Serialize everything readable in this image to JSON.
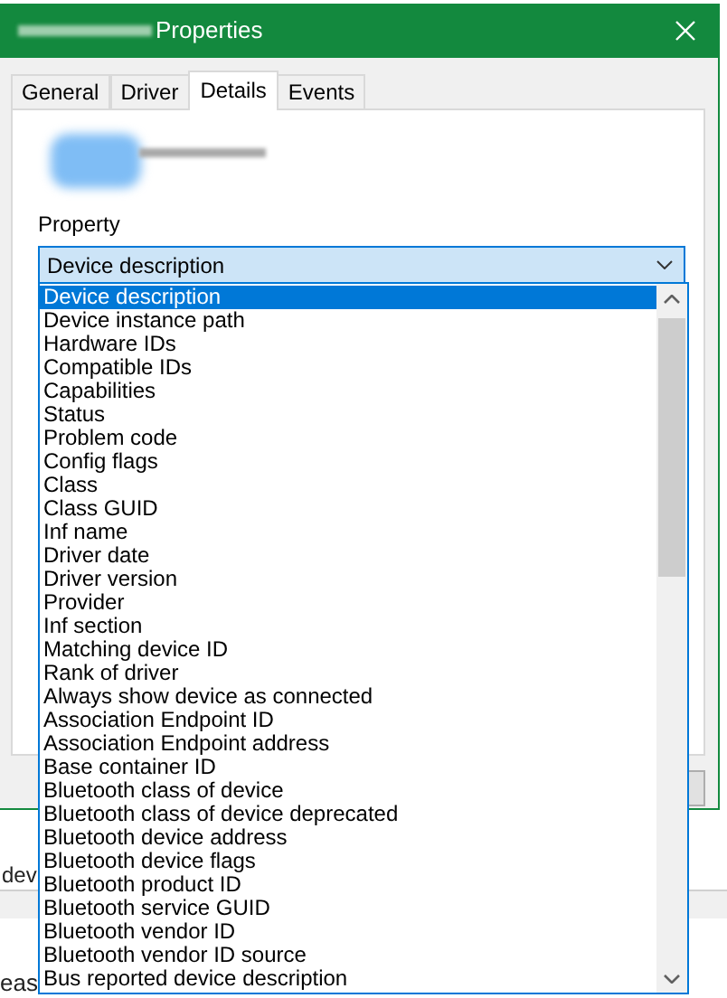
{
  "window": {
    "title": "Properties"
  },
  "tabs": [
    {
      "label": "General",
      "selected": false
    },
    {
      "label": "Driver",
      "selected": false
    },
    {
      "label": "Details",
      "selected": true
    },
    {
      "label": "Events",
      "selected": false
    }
  ],
  "property_label": "Property",
  "property_combo": {
    "value": "Device description",
    "expanded": true
  },
  "dropdown_items": [
    {
      "label": "Device description",
      "selected": true
    },
    {
      "label": "Device instance path",
      "selected": false
    },
    {
      "label": "Hardware IDs",
      "selected": false
    },
    {
      "label": "Compatible IDs",
      "selected": false
    },
    {
      "label": "Capabilities",
      "selected": false
    },
    {
      "label": "Status",
      "selected": false
    },
    {
      "label": "Problem code",
      "selected": false
    },
    {
      "label": "Config flags",
      "selected": false
    },
    {
      "label": "Class",
      "selected": false
    },
    {
      "label": "Class GUID",
      "selected": false
    },
    {
      "label": "Inf name",
      "selected": false
    },
    {
      "label": "Driver date",
      "selected": false
    },
    {
      "label": "Driver version",
      "selected": false
    },
    {
      "label": "Provider",
      "selected": false
    },
    {
      "label": "Inf section",
      "selected": false
    },
    {
      "label": "Matching device ID",
      "selected": false
    },
    {
      "label": "Rank of driver",
      "selected": false
    },
    {
      "label": "Always show device as connected",
      "selected": false
    },
    {
      "label": "Association Endpoint ID",
      "selected": false
    },
    {
      "label": "Association Endpoint address",
      "selected": false
    },
    {
      "label": "Base container ID",
      "selected": false
    },
    {
      "label": "Bluetooth class of device",
      "selected": false
    },
    {
      "label": "Bluetooth class of device deprecated",
      "selected": false
    },
    {
      "label": "Bluetooth device address",
      "selected": false
    },
    {
      "label": "Bluetooth device flags",
      "selected": false
    },
    {
      "label": "Bluetooth product ID",
      "selected": false
    },
    {
      "label": "Bluetooth service GUID",
      "selected": false
    },
    {
      "label": "Bluetooth vendor ID",
      "selected": false
    },
    {
      "label": "Bluetooth vendor ID source",
      "selected": false
    },
    {
      "label": "Bus reported device description",
      "selected": false
    }
  ],
  "background_page": {
    "fragment": "dev",
    "sentence": "eas"
  }
}
